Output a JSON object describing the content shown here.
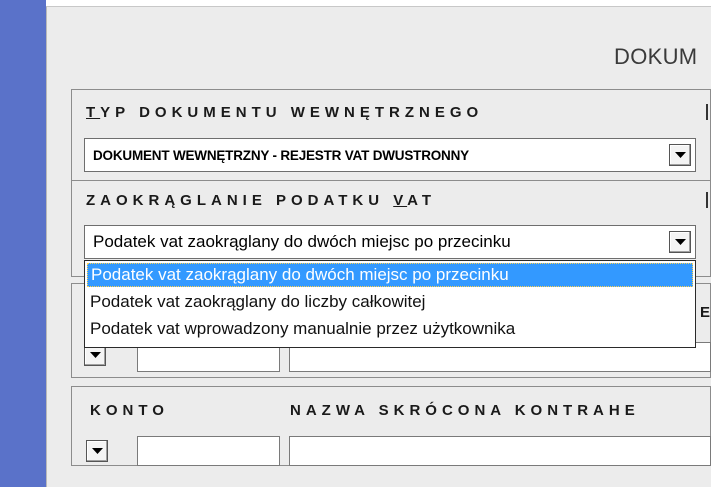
{
  "window": {
    "title": "DOKUM"
  },
  "typ_dokumentu": {
    "label_first": "T",
    "label_rest": "YP DOKUMENTU WEWNĘTRZNEGO",
    "value": "DOKUMENT WEWNĘTRZNY - REJESTR VAT DWUSTRONNY"
  },
  "zaokraglanie": {
    "label_before": "ZAOKRĄGLANIE PODATKU ",
    "label_underlined": "V",
    "label_after": "AT",
    "value": "Podatek vat zaokrąglany do dwóch miejsc po przecinku",
    "options": [
      "Podatek vat zaokrąglany do dwóch miejsc po przecinku",
      "Podatek vat zaokrąglany do liczby całkowitej",
      "Podatek vat wprowadzony manualnie przez użytkownika"
    ],
    "selected_index": 0
  },
  "konto_section": {
    "konto_label": "KONTO",
    "nazwa_label": "NAZWA SKRÓCONA KONTRAHE"
  },
  "edge_fragments": {
    "e_letter": "E"
  },
  "colors": {
    "desktop": "#5a72c9",
    "window_bg": "#ececec",
    "selection": "#3399ff"
  },
  "icons": {
    "dropdown": "chevron-down-icon"
  }
}
